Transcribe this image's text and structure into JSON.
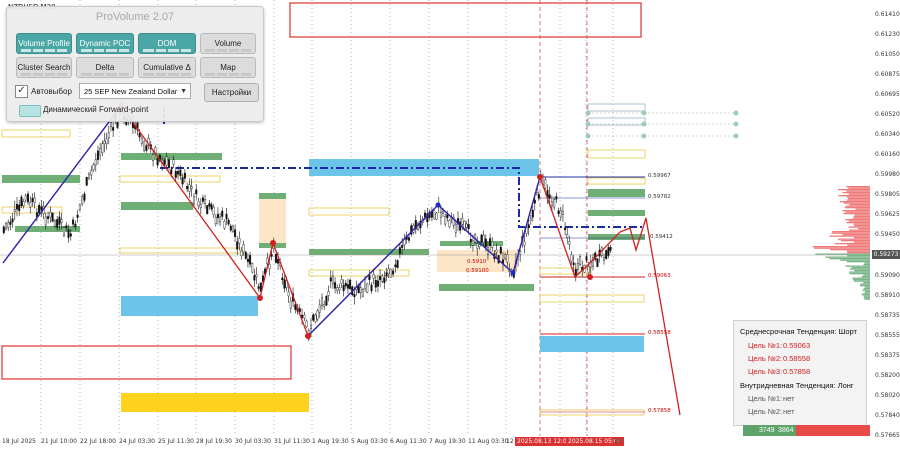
{
  "symbol": "NZDUSD,M30",
  "provolume": {
    "title": "ProVolume 2.07",
    "buttons": [
      {
        "label": "Volume Profile",
        "active": true
      },
      {
        "label": "Dynamic POC",
        "active": true
      },
      {
        "label": "DOM",
        "active": true
      },
      {
        "label": "Volume",
        "active": false
      },
      {
        "label": "Cluster Search",
        "active": false
      },
      {
        "label": "Delta",
        "active": false
      },
      {
        "label": "Cumulative Δ",
        "active": false
      },
      {
        "label": "Map",
        "active": false
      }
    ],
    "auto_select_label": "Автовыбор",
    "auto_select_checked": true,
    "instrument_value": "25 SEP New Zealand Dollar",
    "settings_label": "Настройки",
    "forward_point_label": "Динамический Forward-point"
  },
  "price_scale": [
    "0.61410",
    "0.61230",
    "0.61050",
    "0.60875",
    "0.60695",
    "0.60520",
    "0.60340",
    "0.60160",
    "0.59980",
    "0.59805",
    "0.59625",
    "0.59450",
    "0.59270",
    "0.59090",
    "0.58910",
    "0.58735",
    "0.58555",
    "0.58375",
    "0.58200",
    "0.58020",
    "0.57840",
    "0.57665"
  ],
  "current_price": "0.59273",
  "time_axis": [
    "18 Jul 2025",
    "21 Jul 10:00",
    "22 Jul 18:00",
    "24 Jul 03:30",
    "25 Jul 11:30",
    "28 Jul 19:30",
    "30 Jul 03:30",
    "31 Jul 11:30",
    "1 Aug 19:30",
    "5 Aug 03:30",
    "6 Aug 11:30",
    "7 Aug 19:30",
    "11 Aug 03:30",
    "12 Aug 11:30"
  ],
  "time_highlights": [
    "2025.08.13 12:00",
    "2025.08.15 05:00"
  ],
  "time_tail": "30",
  "level_labels": {
    "l1": "0.59967",
    "l2": "0.59782",
    "l3": "0.59412",
    "l4": "0.59063",
    "l5": "0.58558",
    "l6": "0.57858",
    "l7": "0.5910",
    "l8": "0.59100"
  },
  "trend": {
    "mid_title": "Среднесрочная Тенденция: Шорт",
    "targets": [
      {
        "label": "Цель №1:",
        "value": "0.59063"
      },
      {
        "label": "Цель №2:",
        "value": "0.58558"
      },
      {
        "label": "Цель №3:",
        "value": "0.57858"
      }
    ],
    "intra_title": "Внутридневная Тенденция: Лонг",
    "intra_targets": [
      {
        "label": "Цель №1:",
        "value": "нет"
      },
      {
        "label": "Цель №2:",
        "value": "нет"
      }
    ]
  },
  "volumes": {
    "buy": "3749",
    "sell": "3864"
  },
  "colors": {
    "accent": "#4aa7a5",
    "bull": "#5da36a",
    "bear": "#e84a4a",
    "zone_blue": "#5bbde6",
    "zone_yellow": "#ffd21e"
  }
}
